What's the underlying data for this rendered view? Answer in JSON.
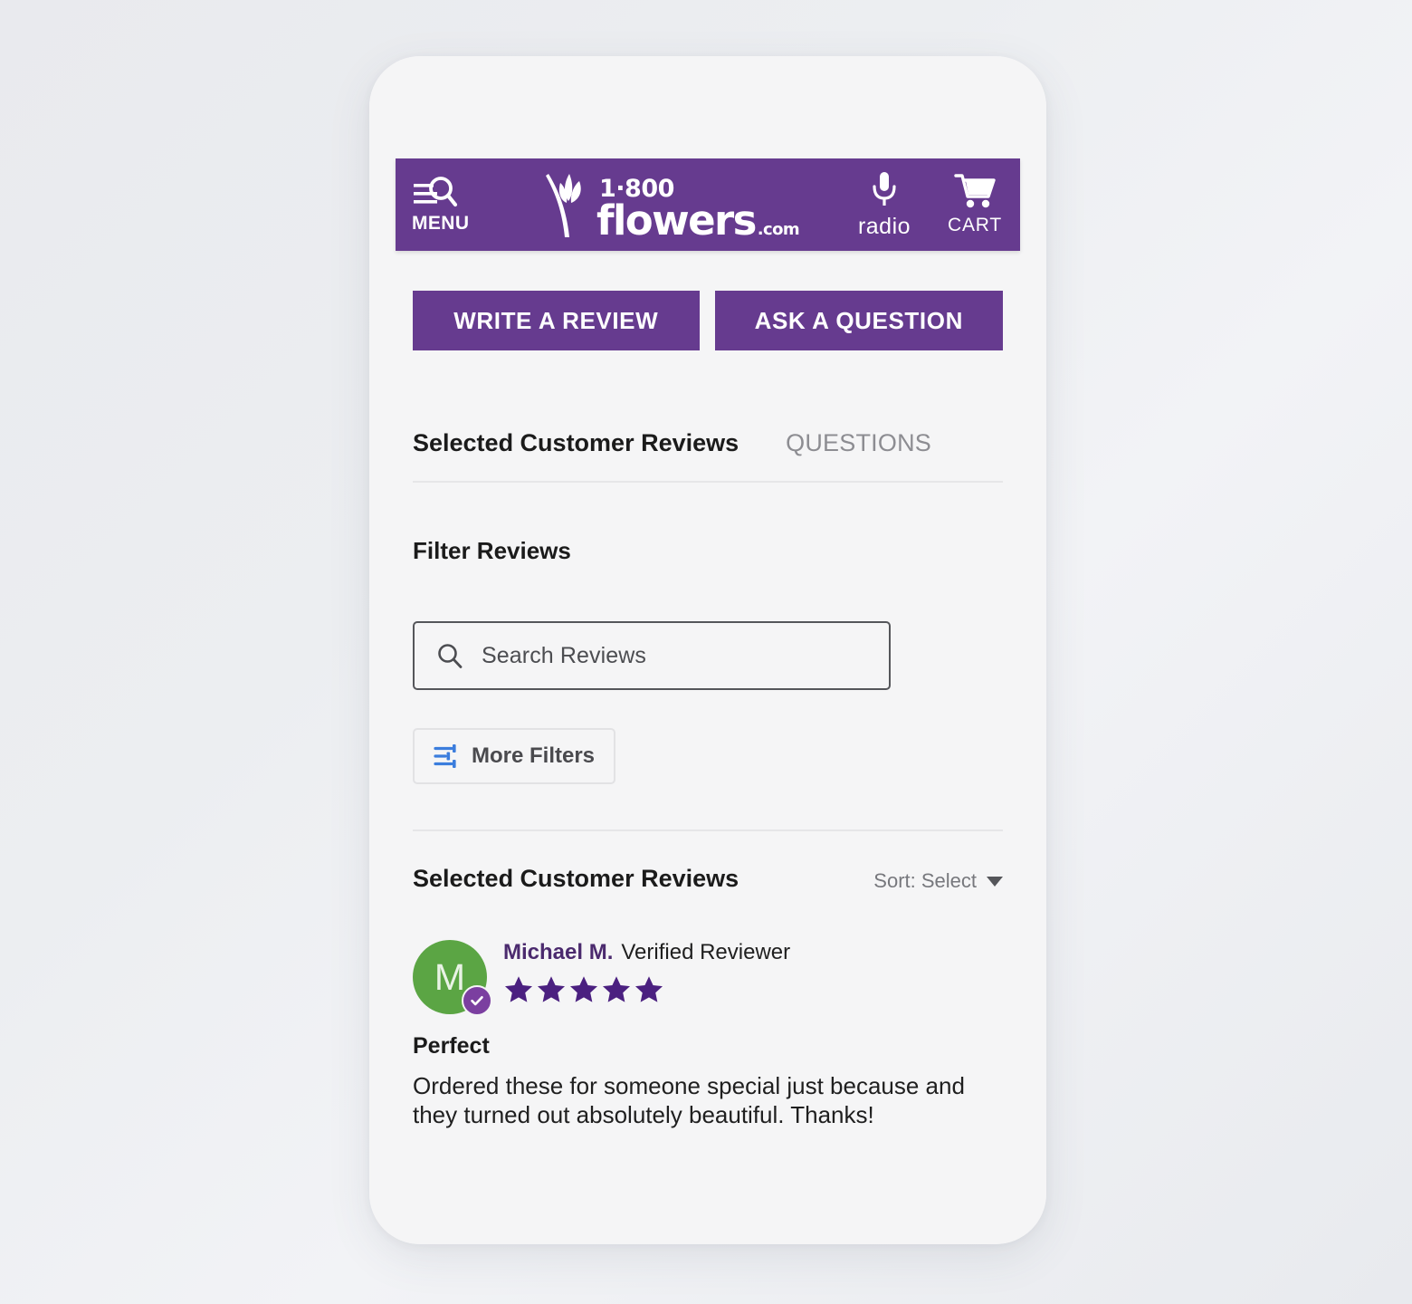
{
  "colors": {
    "brand_purple": "#663b8f",
    "badge_purple": "#7b3fa0",
    "avatar_green": "#5ba544",
    "star_purple": "#4b2080",
    "filter_icon_blue": "#3b7ddd",
    "page_bg": "#ecedf1",
    "screen_bg": "#f5f5f6"
  },
  "header": {
    "menu": {
      "icon": "menu-search-icon",
      "label": "MENU"
    },
    "logo": {
      "icon": "flower-tulip-icon",
      "phone": "1·800",
      "name": "flowers",
      "tld": ".com"
    },
    "actions": [
      {
        "id": "radio",
        "icon": "microphone-icon",
        "label": "radio"
      },
      {
        "id": "cart",
        "icon": "shopping-cart-icon",
        "label": "CART"
      }
    ]
  },
  "cta": {
    "write_review": "WRITE A REVIEW",
    "ask_question": "ASK A QUESTION"
  },
  "tabs": [
    {
      "id": "reviews",
      "label": "Selected Customer Reviews",
      "active": true
    },
    {
      "id": "questions",
      "label": "QUESTIONS",
      "active": false
    }
  ],
  "filters": {
    "heading": "Filter Reviews",
    "search": {
      "icon": "search-icon",
      "placeholder": "Search Reviews",
      "value": ""
    },
    "more_filters": {
      "icon": "tune-sliders-icon",
      "label": "More Filters"
    }
  },
  "reviews_section": {
    "title": "Selected Customer Reviews",
    "sort": {
      "label": "Sort: Select",
      "caret": "chevron-down-icon",
      "options": [
        "Select"
      ]
    },
    "items": [
      {
        "avatar_initial": "M",
        "avatar_color": "#5ba544",
        "verified_badge_icon": "check-circle-icon",
        "reviewer": "Michael M.",
        "verified_text": "Verified Reviewer",
        "rating": 5,
        "max_rating": 5,
        "title": "Perfect",
        "body": "Ordered these for someone special just because and they turned out absolutely beautiful. Thanks!"
      }
    ]
  }
}
